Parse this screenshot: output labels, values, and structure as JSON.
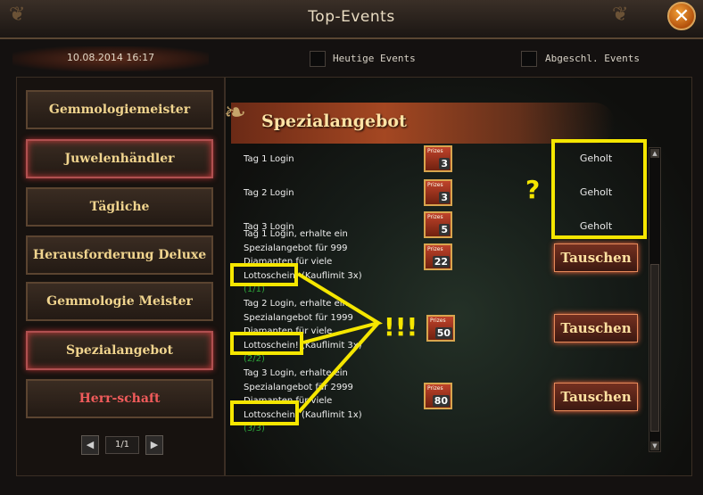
{
  "window": {
    "title": "Top-Events",
    "close_label": "✕"
  },
  "header": {
    "datetime": "10.08.2014 16:17",
    "filters": [
      {
        "label": "Heutige Events",
        "checked": false
      },
      {
        "label": "Abgeschl. Events",
        "checked": false
      }
    ]
  },
  "sidebar": {
    "items": [
      {
        "label": "Gemmologiemeister",
        "highlighted": false
      },
      {
        "label": "Juwelenhändler",
        "highlighted": true
      },
      {
        "label": "Tägliche Herausforderung",
        "highlighted": false
      },
      {
        "label": "Herausforderung Deluxe",
        "highlighted": false
      },
      {
        "label": "Gemmologie Meister",
        "highlighted": false
      },
      {
        "label": "Spezialangebot",
        "highlighted": true
      },
      {
        "label": "Herr-schaft",
        "highlighted": false
      }
    ],
    "pager": {
      "label": "1/1",
      "prev_icon": "chevron-left-icon",
      "next_icon": "chevron-right-icon"
    }
  },
  "main": {
    "banner_title": "Spezialangebot",
    "prize_caption": "Prizes",
    "simple_rows": [
      {
        "text": "Tag 1 Login",
        "prize_count": "3",
        "status": "Geholt"
      },
      {
        "text": "Tag 2 Login",
        "prize_count": "3",
        "status": "Geholt"
      },
      {
        "text": "Tag 3 Login",
        "prize_count": "5",
        "status": "Geholt"
      }
    ],
    "offer_rows": [
      {
        "lines": [
          "Tag 1 Login, erhalte ein",
          "Spezialangebot für 999",
          "Diamanten für viele",
          "Lottoschein! (Kauflimit 3x)"
        ],
        "progress": "(1/1)",
        "prize_count": "22",
        "button": "Tauschen"
      },
      {
        "lines": [
          "Tag 2 Login, erhalte ein",
          "Spezialangebot für 1999",
          "Diamanten für viele",
          "Lottoschein! (Kauflimit 3x)"
        ],
        "progress": "(2/2)",
        "prize_count": "50",
        "button": "Tauschen"
      },
      {
        "lines": [
          "Tag 3 Login, erhalte ein",
          "Spezialangebot für 2999",
          "Diamanten für viele",
          "Lottoschein! (Kauflimit 1x)"
        ],
        "progress": "(3/3)",
        "prize_count": "80",
        "button": "Tauschen"
      }
    ]
  },
  "annotations": {
    "question_mark": "?",
    "exclamations": "!!!",
    "highlight_color": "#f5e600"
  }
}
